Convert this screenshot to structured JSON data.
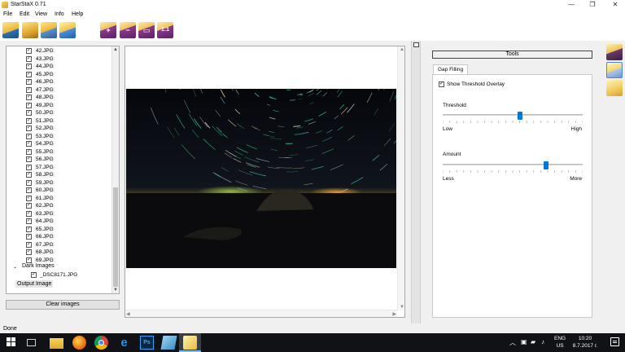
{
  "window": {
    "title": "StarStaX 0.71",
    "controls": [
      "—",
      "❐",
      "✕"
    ]
  },
  "menu": [
    "File",
    "Edit",
    "View",
    "Info",
    "Help"
  ],
  "toolbar": {
    "buttons": [
      "open-images",
      "open-folder",
      "save-image",
      "export",
      "zoom-in",
      "zoom-out",
      "fit-to-window",
      "zoom-1-1"
    ],
    "zoom_in_glyph": "+",
    "zoom_out_glyph": "−",
    "fit_glyph": "▭",
    "one_to_one_glyph": "1:1"
  },
  "file_list": {
    "files": [
      "42.JPG",
      "43.JPG",
      "44.JPG",
      "45.JPG",
      "46.JPG",
      "47.JPG",
      "48.JPG",
      "49.JPG",
      "50.JPG",
      "51.JPG",
      "52.JPG",
      "53.JPG",
      "54.JPG",
      "55.JPG",
      "56.JPG",
      "57.JPG",
      "58.JPG",
      "59.JPG",
      "60.JPG",
      "61.JPG",
      "62.JPG",
      "63.JPG",
      "64.JPG",
      "65.JPG",
      "66.JPG",
      "67.JPG",
      "68.JPG",
      "69.JPG"
    ],
    "check_glyph": "✓",
    "dark_images_label": "Dark Images",
    "dark_toggle_glyph": "⌄",
    "dark_file": "_DSC8171.JPG",
    "output_label": "Output Image",
    "scroll_up_glyph": "▲",
    "scroll_down_glyph": "▼"
  },
  "clear_button": "Clear images",
  "tools": {
    "header": "Tools",
    "tab": "Gap Filling",
    "show_overlay_label": "Show Threshold Overlay",
    "show_overlay_checked": true,
    "threshold": {
      "label": "Threshold",
      "min_label": "Low",
      "max_label": "High",
      "value": 0.55
    },
    "amount": {
      "label": "Amount",
      "min_label": "Less",
      "max_label": "More",
      "value": 0.74
    }
  },
  "status": "Done",
  "taskbar": {
    "apps": [
      "start-icon",
      "task-view-icon",
      "file-explorer-icon",
      "firefox-icon",
      "chrome-icon",
      "edge-icon",
      "photoshop-icon",
      "notes-icon",
      "starstax-icon"
    ],
    "edge_glyph": "e",
    "ps_glyph": "Ps",
    "tray_up_glyph": "︿",
    "tray_icons_glyphs": [
      "▣",
      "▰",
      "♪"
    ],
    "lang_line1": "ENG",
    "lang_line2": "US",
    "time": "10:20",
    "date": "8.7.2017 г."
  },
  "colors": {
    "accent": "#0078d7",
    "taskbar": "#101216",
    "sky_top": "#04060b",
    "horizon_glow": "#8a6a2a",
    "trail_green": "#3fd19a"
  }
}
